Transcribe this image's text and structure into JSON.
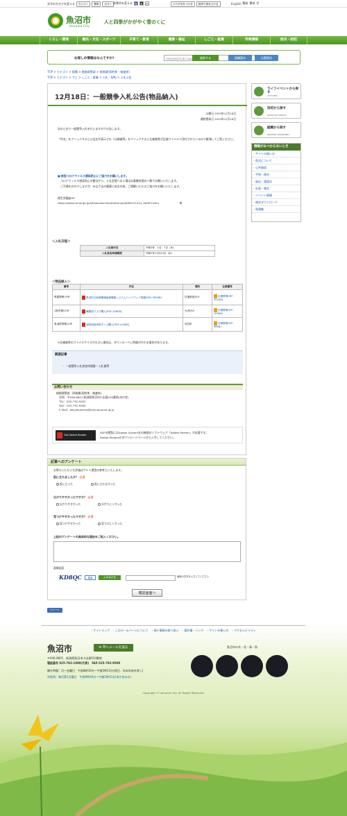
{
  "util": {
    "fontsize_label": "文字の大きさを変える",
    "fontsize_buttons": [
      "ちいさく",
      "標準",
      "大きく"
    ],
    "color_label": "背景色を変える",
    "color_buttons": [
      "青",
      "黒",
      "白"
    ],
    "link1": "ふりがなをつける",
    "link2": "音声で読み上げる",
    "langs": [
      "English",
      "簡体",
      "繁体",
      "한"
    ]
  },
  "header": {
    "site_name": "魚沼市",
    "site_en": "Uonuma City",
    "tagline": "人と四季がかがやく雪のくに"
  },
  "nav": [
    "くらし・環境",
    "観光・文化・スポーツ",
    "子育て・教育",
    "健康・福祉",
    "しごと・産業",
    "市政情報",
    "防災・防犯"
  ],
  "search": {
    "question": "お探しの情報はなんですか?",
    "placeholder": "ENHANCED BY Google",
    "search_btn": "検索する",
    "org_btn": "組織案内",
    "purpose_btn": "分野案内"
  },
  "breadcrumb1": [
    "TOP",
    "カテゴリ",
    "組織",
    "総務政策部",
    "財務課(契約係・検査係)"
  ],
  "breadcrumb2": [
    "TOP",
    "カテゴリ",
    "ナビ",
    "しごと・産業",
    "入札・契約",
    "入札公告"
  ],
  "article": {
    "title": "12月18日：一般競争入札公告(物品納入)",
    "published": "公開日 2020年12月18日",
    "updated": "最終更新日 2020年12月18日",
    "intro": "次のとおり一般競争入札を行いますので公告します。",
    "note": "「件名」をクリックすると公告文が表示され「仕様書等」をクリックすると仕様書等が圧縮ファイルで添付されているので解凍してご覧ください。",
    "corona_title": "新型コロナウイルス感染防止にご協力をお願いします。",
    "corona_body1": "コロナウィルス感染防止の観点から、入札会場への入場は必要最低限の人数でお願いいたします。",
    "corona_body2": "ご不便をおかけしますが、みなさまの健康と安全の為、ご理解いただきご協力をお願いいたします。",
    "mhlw": "厚生労働省HP",
    "mhlw_url": "https://www.mhlw.go.jp/stf/seisakunitsuite/bunya/0000121431_00093.html",
    "schedule_head": "＜入札日程＞",
    "schedule": [
      [
        "入札執行日",
        "令和3年　1月　7日（木）"
      ],
      [
        "入札参加申請期限",
        "令和2年12月23日（水）"
      ]
    ],
    "items_head": "＜物品納入＞",
    "items_cols": [
      "番号",
      "件名",
      "場所",
      "仕様書等"
    ],
    "items": [
      [
        "魚建物第19号",
        "魚沼市立医療情報医療情報システムハードウェア調達[PDF-589KB]",
        "日渡新田ほか",
        "仕様書等[ZIP-452KB]"
      ],
      [
        "2魚市第51号",
        "備蓄用マスク購入[PDF-428KB]",
        "大沢ほか",
        "仕様書等[ZIP-109KB]"
      ],
      [
        "魚消防物第12号",
        "消防団用消防ホース購入[PDF-426KB]",
        "四日町",
        "仕様書等[ZIP-98KB]"
      ]
    ],
    "size_note": "※仕様書等のファイルサイズが大きい場合は、ダウンロードに時間がかかる場合があります。",
    "related_head": "関連記事",
    "related_link": "一般競争入札参加申請書・入札書等",
    "contact_head": "お問い合わせ",
    "contact_lines": [
      "総務政策部　財務課(契約係・検査係)",
      "住所：〒946-8601 新潟県魚沼市小出島910番地(本庁舎)",
      "TEL：025-792-9205",
      "FAX：025-792-9500",
      "E-Mail：keiyakukensa@city.uonuma.lg.jp"
    ],
    "adobe_badge": "Get Adobe Reader",
    "adobe_text1": "PDFの閲覧にはAdobe System社の無償のソフトウェア「Adobe Reader」が必要です。",
    "adobe_text2": "Adobe Readerのダウンロードページから入手してください。"
  },
  "survey": {
    "head": "記事へのアンケート",
    "intro": "お寄せいただいた評価はサイト運営の参考といたします。",
    "q1": "役に立ちましたか？",
    "q1_opts": [
      "役に立った",
      "役に立たなかった"
    ],
    "q2": "分かりやすかったですか？",
    "q2_opts": [
      "分かりやすかった",
      "分かりにくかった"
    ],
    "q3": "見つけやすかったですか？",
    "q3_opts": [
      "見つけやすかった",
      "見つけにくかった"
    ],
    "required": "必須",
    "reason": "上記のアンケートの具体的な理由をご記入ください。",
    "captcha_label": "画像認証",
    "captcha": "KD8QC",
    "refresh": "更新",
    "audio": "よみあげる",
    "captcha_hint": "画像の文字を入力してください",
    "confirm": "確認画面へ"
  },
  "sidebar": {
    "btn1": {
      "title": "ライフイベントから探す",
      "en": "LIFE EVENT"
    },
    "btn2": {
      "title": "目的から探す",
      "en": "SEARCH BY PURPOSE"
    },
    "btn3": {
      "title": "組織から探す",
      "en": "SEARCHBY DEPARTMENT"
    },
    "box_head": "情報がみつからないとき",
    "links": [
      "サイトの使い方",
      "魚沼について",
      "公共施設",
      "手続・様式",
      "届出・諸届出",
      "計画・報告",
      "イベント情報",
      "様式ダウンロード",
      "例規集"
    ]
  },
  "tweet": "ツイート",
  "footer": {
    "links": [
      "サイトマップ",
      "このホームページについて",
      "個人情報の取り扱い",
      "著作権・リンク",
      "サイトの使い方",
      "アクセシビリティ"
    ],
    "name": "魚沼市",
    "mail_btn": "市へメールを送る",
    "address": "〒946-8601　新潟県魚沼市小出島910番地",
    "phone": "電話番号 025-792-1000(代表)　FAX 025-792-9500",
    "hours": "開庁時間：月～金曜日　午前8時30分～午後5時15分(祝日、年末年始を除く)",
    "branch": "市役所：毎月第1日曜日　午前8時30分～午後5時15分(本庁舎のみ)",
    "emblem_title": "魚沼市の木・花・鳥・魚",
    "copyright": "Copyright © Uonuma City. All Rights Reserved."
  }
}
